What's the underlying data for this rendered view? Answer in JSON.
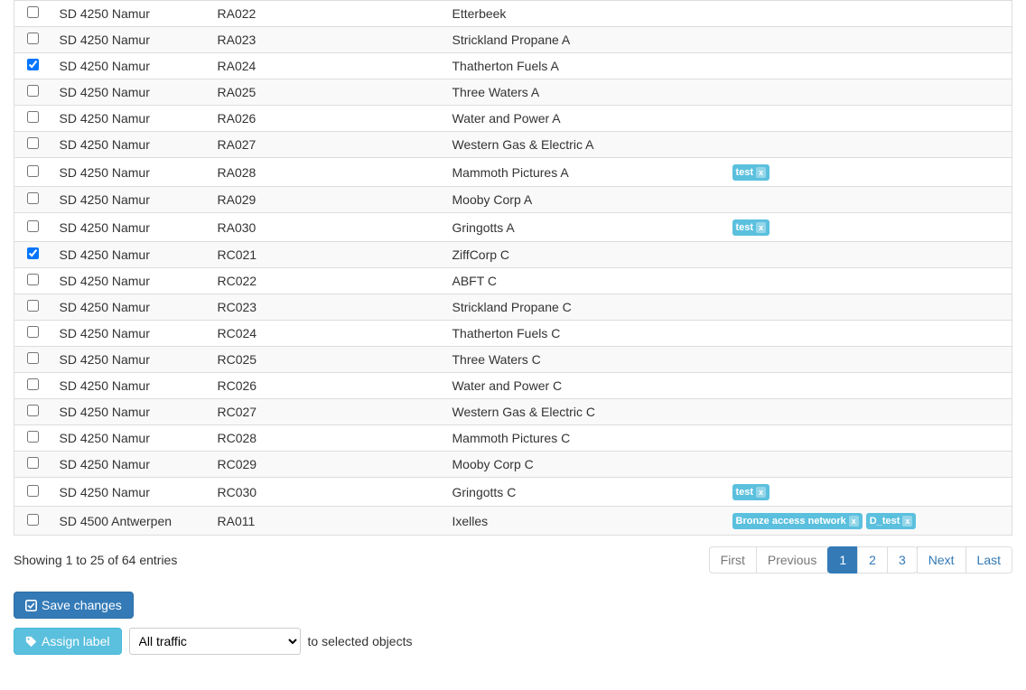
{
  "rows": [
    {
      "checked": false,
      "name": "SD 4250 Namur",
      "code": "RA022",
      "company": "Etterbeek",
      "tags": []
    },
    {
      "checked": false,
      "name": "SD 4250 Namur",
      "code": "RA023",
      "company": "Strickland Propane A",
      "tags": []
    },
    {
      "checked": true,
      "name": "SD 4250 Namur",
      "code": "RA024",
      "company": "Thatherton Fuels A",
      "tags": []
    },
    {
      "checked": false,
      "name": "SD 4250 Namur",
      "code": "RA025",
      "company": "Three Waters A",
      "tags": []
    },
    {
      "checked": false,
      "name": "SD 4250 Namur",
      "code": "RA026",
      "company": "Water and Power A",
      "tags": []
    },
    {
      "checked": false,
      "name": "SD 4250 Namur",
      "code": "RA027",
      "company": "Western Gas & Electric A",
      "tags": []
    },
    {
      "checked": false,
      "name": "SD 4250 Namur",
      "code": "RA028",
      "company": "Mammoth Pictures A",
      "tags": [
        "test"
      ]
    },
    {
      "checked": false,
      "name": "SD 4250 Namur",
      "code": "RA029",
      "company": "Mooby Corp A",
      "tags": []
    },
    {
      "checked": false,
      "name": "SD 4250 Namur",
      "code": "RA030",
      "company": "Gringotts A",
      "tags": [
        "test"
      ]
    },
    {
      "checked": true,
      "name": "SD 4250 Namur",
      "code": "RC021",
      "company": "ZiffCorp C",
      "tags": []
    },
    {
      "checked": false,
      "name": "SD 4250 Namur",
      "code": "RC022",
      "company": "ABFT C",
      "tags": []
    },
    {
      "checked": false,
      "name": "SD 4250 Namur",
      "code": "RC023",
      "company": "Strickland Propane C",
      "tags": []
    },
    {
      "checked": false,
      "name": "SD 4250 Namur",
      "code": "RC024",
      "company": "Thatherton Fuels C",
      "tags": []
    },
    {
      "checked": false,
      "name": "SD 4250 Namur",
      "code": "RC025",
      "company": "Three Waters C",
      "tags": []
    },
    {
      "checked": false,
      "name": "SD 4250 Namur",
      "code": "RC026",
      "company": "Water and Power C",
      "tags": []
    },
    {
      "checked": false,
      "name": "SD 4250 Namur",
      "code": "RC027",
      "company": "Western Gas & Electric C",
      "tags": []
    },
    {
      "checked": false,
      "name": "SD 4250 Namur",
      "code": "RC028",
      "company": "Mammoth Pictures C",
      "tags": []
    },
    {
      "checked": false,
      "name": "SD 4250 Namur",
      "code": "RC029",
      "company": "Mooby Corp C",
      "tags": []
    },
    {
      "checked": false,
      "name": "SD 4250 Namur",
      "code": "RC030",
      "company": "Gringotts C",
      "tags": [
        "test"
      ]
    },
    {
      "checked": false,
      "name": "SD 4500 Antwerpen",
      "code": "RA011",
      "company": "Ixelles",
      "tags": [
        "Bronze access network",
        "D_test"
      ]
    }
  ],
  "info_text": "Showing 1 to 25 of 64 entries",
  "pagination": {
    "first": "First",
    "previous": "Previous",
    "pages": [
      "1",
      "2",
      "3"
    ],
    "active_index": 0,
    "next": "Next",
    "last": "Last"
  },
  "buttons": {
    "save_changes": "Save changes",
    "assign_label": "Assign label"
  },
  "assign": {
    "selected_option": "All traffic",
    "suffix": "to selected objects"
  }
}
